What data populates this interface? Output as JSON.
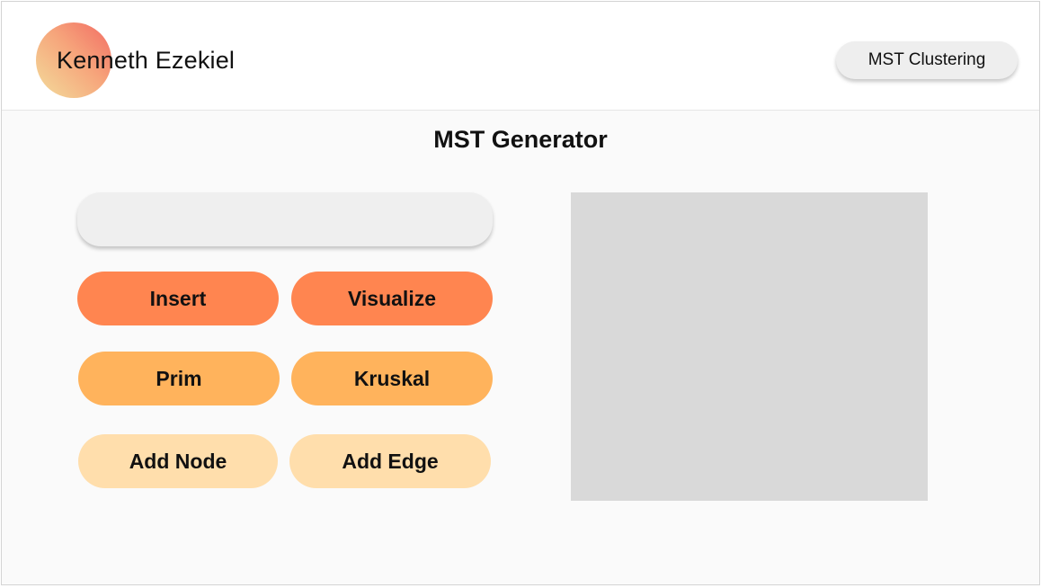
{
  "header": {
    "brand_name": "Kenneth Ezekiel",
    "nav_button_label": "MST Clustering"
  },
  "main": {
    "title": "MST Generator",
    "input": {
      "value": "",
      "placeholder": ""
    },
    "buttons": {
      "insert": "Insert",
      "visualize": "Visualize",
      "prim": "Prim",
      "kruskal": "Kruskal",
      "add_node": "Add Node",
      "add_edge": "Add Edge"
    }
  },
  "colors": {
    "primary_button": "#ff8550",
    "secondary_button": "#ffb35c",
    "tertiary_button": "#ffdeac",
    "canvas": "#d9d9d9",
    "logo_gradient": [
      "#f26b63",
      "#f6a57b",
      "#f3dd9c"
    ]
  }
}
